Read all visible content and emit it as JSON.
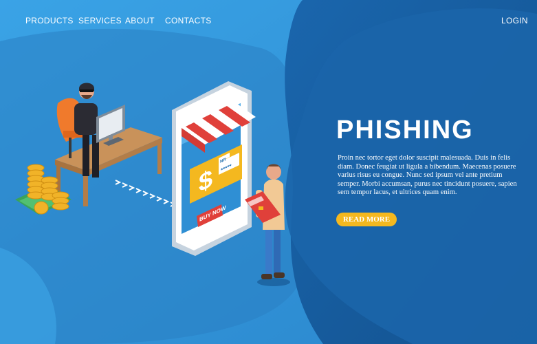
{
  "nav": {
    "products": "PRODUCTS",
    "services": "SERVICES",
    "about": "ABOUT",
    "contacts": "CONTACTS",
    "login": "LOGIN"
  },
  "hero": {
    "title": "PHISHING",
    "body": "Proin nec tortor eget dolor suscipit malesuada. Duis in felis diam. Donec feugiat ut ligula a bibendum. Maecenas posuere varius risus eu congue. Nunc sed ipsum vel ante pretium semper. Morbi accumsan, purus nec tincidunt posuere, sapien sem tempor lacus, et ultrices quam enim.",
    "button": "READ MORE"
  },
  "illustration": {
    "buy_now": "BUY NOW",
    "currency_symbol": "$",
    "card_field_label": "NR",
    "card_field_value": "*****"
  },
  "colors": {
    "background": "#1e6fb4",
    "accent": "#f4b81f",
    "sale_red": "#e0403a"
  }
}
